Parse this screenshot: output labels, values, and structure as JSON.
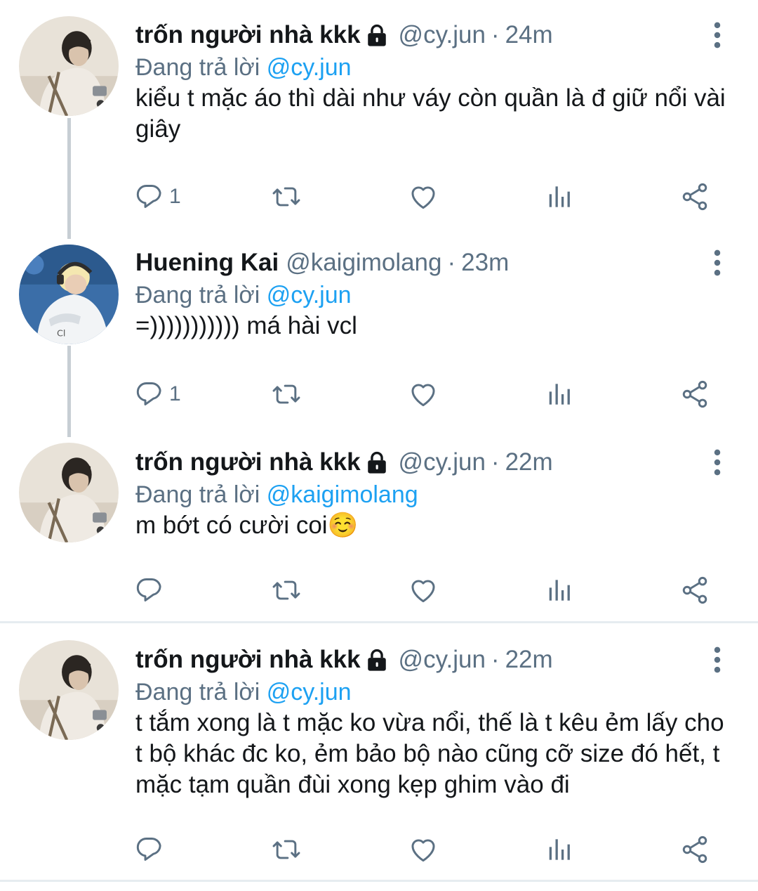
{
  "tweets": [
    {
      "name": "trốn người nhà kkk",
      "locked": true,
      "handle": "@cy.jun",
      "separator": "·",
      "time": "24m",
      "replying_prefix": "Đang trả lời ",
      "replying_to": "@cy.jun",
      "text": "kiểu t mặc áo thì dài như váy còn quần là đ giữ nổi vài giây",
      "reply_count": "1",
      "avatar": "avatar-cy-jun"
    },
    {
      "name": "Huening Kai",
      "locked": false,
      "handle": "@kaigimolang",
      "separator": "·",
      "time": "23m",
      "replying_prefix": "Đang trả lời ",
      "replying_to": "@cy.jun",
      "text": "=))))))))))) má hài vcl",
      "reply_count": "1",
      "avatar": "avatar-kaigimolang"
    },
    {
      "name": "trốn người nhà kkk",
      "locked": true,
      "handle": "@cy.jun",
      "separator": "·",
      "time": "22m",
      "replying_prefix": "Đang trả lời ",
      "replying_to": "@kaigimolang",
      "text": "m bớt có cười coi☺️",
      "reply_count": "",
      "avatar": "avatar-cy-jun"
    },
    {
      "name": "trốn người nhà kkk",
      "locked": true,
      "handle": "@cy.jun",
      "separator": "·",
      "time": "22m",
      "replying_prefix": "Đang trả lời ",
      "replying_to": "@cy.jun",
      "text": "t tắm xong là t mặc ko vừa nổi, thế là t kêu ẻm lấy cho t bộ khác đc ko, ẻm bảo bộ nào cũng cỡ size đó hết, t mặc tạm quần đùi xong kẹp ghim vào đi",
      "reply_count": "",
      "avatar": "avatar-cy-jun"
    }
  ],
  "icons": {
    "reply": "reply-icon",
    "retweet": "retweet-icon",
    "like": "heart-icon",
    "stats": "analytics-icon",
    "share": "share-icon",
    "more": "more-vertical-icon",
    "lock": "lock-icon"
  },
  "colors": {
    "mention": "#1da1f2",
    "secondary_text": "#5b7083",
    "thread_line": "#c7ced4",
    "divider": "#e6ecf0"
  }
}
